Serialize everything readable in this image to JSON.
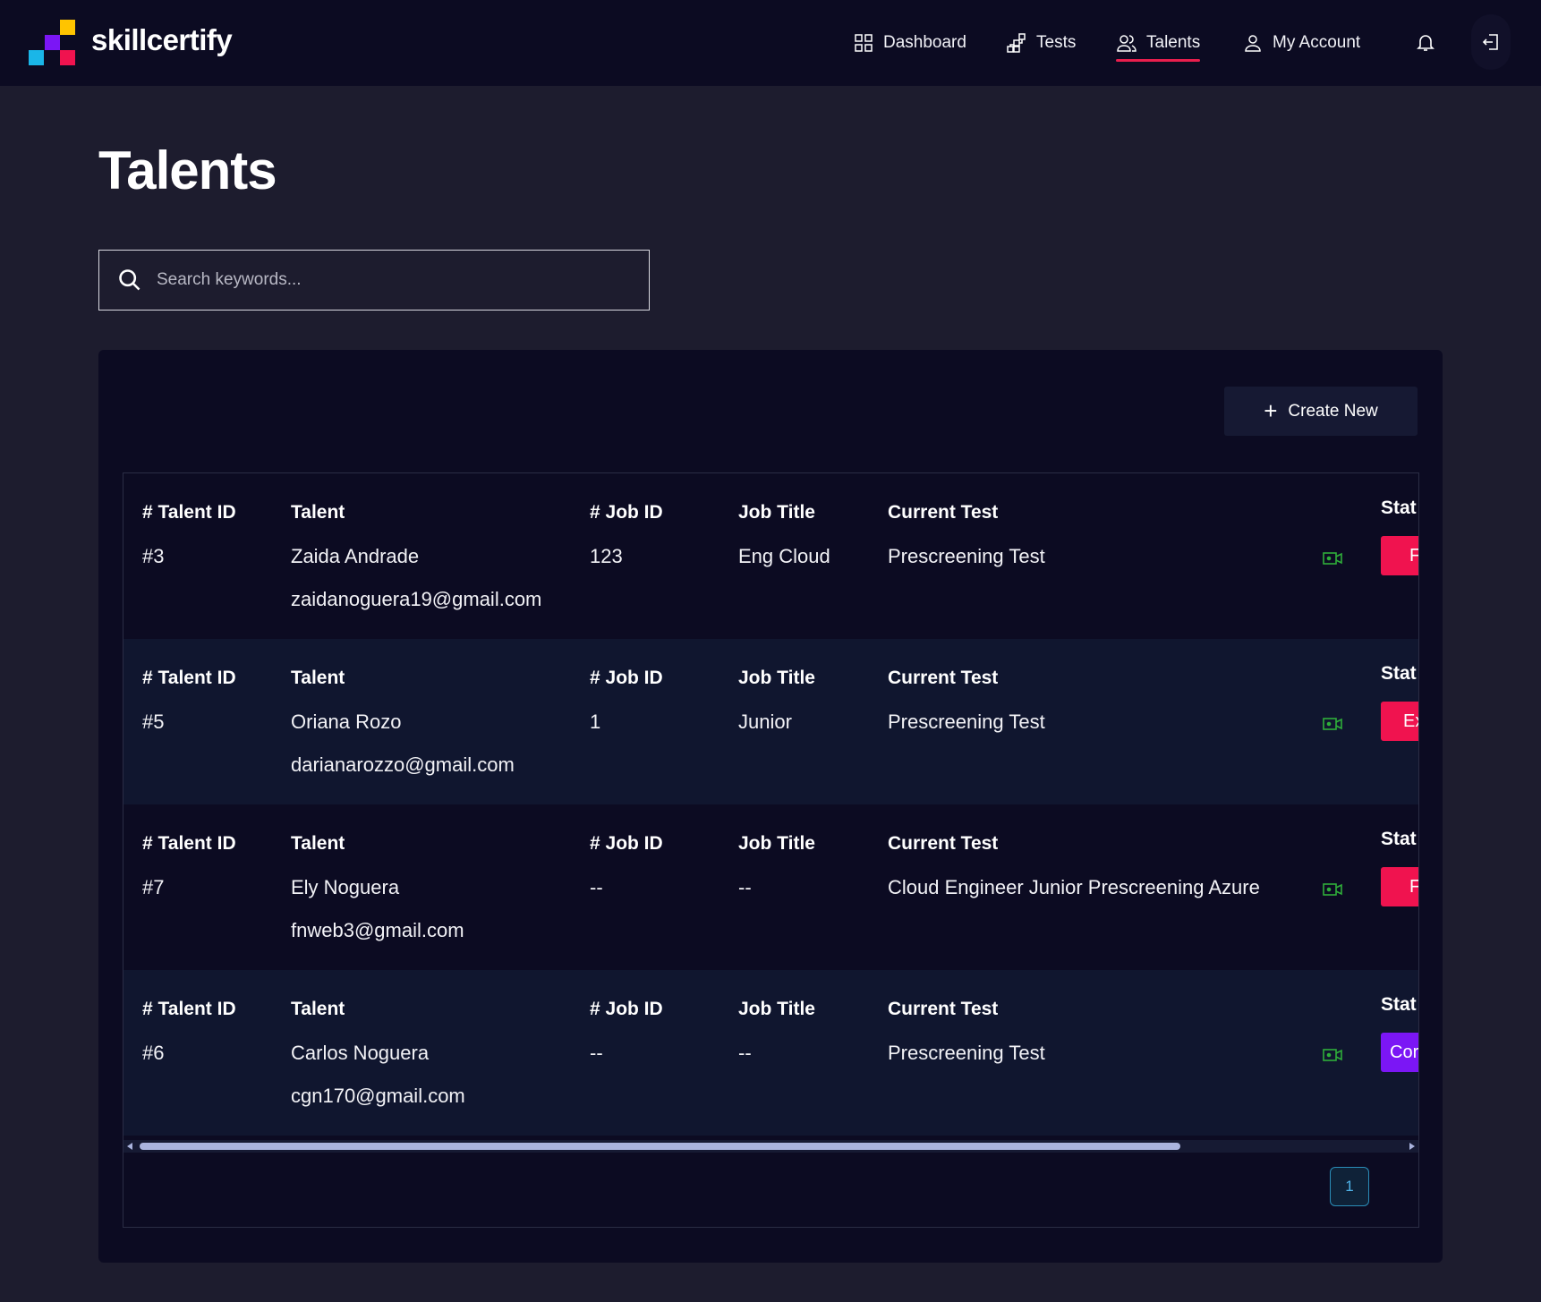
{
  "brand": {
    "name": "skillcertify"
  },
  "nav": {
    "dashboard": "Dashboard",
    "tests": "Tests",
    "talents": "Talents",
    "account": "My Account"
  },
  "page": {
    "title": "Talents"
  },
  "search": {
    "placeholder": "Search keywords..."
  },
  "toolbar": {
    "create_label": "Create New"
  },
  "columns": {
    "talent_id": "# Talent ID",
    "talent": "Talent",
    "job_id": "# Job ID",
    "job_title": "Job Title",
    "current_test": "Current Test",
    "status": "Stat"
  },
  "rows": [
    {
      "talent_id": "#3",
      "name": "Zaida Andrade",
      "email": "zaidanoguera19@gmail.com",
      "job_id": "123",
      "job_title": "Eng Cloud",
      "current_test": "Prescreening Test",
      "status": "F",
      "status_color": "#f0134f"
    },
    {
      "talent_id": "#5",
      "name": "Oriana Rozo",
      "email": "darianarozzo@gmail.com",
      "job_id": "1",
      "job_title": "Junior",
      "current_test": "Prescreening Test",
      "status": "Ex",
      "status_color": "#f0134f"
    },
    {
      "talent_id": "#7",
      "name": "Ely Noguera",
      "email": "fnweb3@gmail.com",
      "job_id": "--",
      "job_title": "--",
      "current_test": "Cloud Engineer Junior Prescreening Azure",
      "status": "F",
      "status_color": "#f0134f"
    },
    {
      "talent_id": "#6",
      "name": "Carlos Noguera",
      "email": "cgn170@gmail.com",
      "job_id": "--",
      "job_title": "--",
      "current_test": "Prescreening Test",
      "status": "Cor",
      "status_color": "#7b16f5"
    }
  ],
  "pagination": {
    "current": "1"
  },
  "icons": {
    "search": "search-icon",
    "dashboard": "grid-icon",
    "tests": "diagram-icon",
    "talents": "users-icon",
    "account": "user-icon",
    "bell": "bell-icon",
    "logout": "logout-icon",
    "video": "video-icon"
  },
  "colors": {
    "accent": "#e91e4d",
    "logo": [
      "#ffc400",
      "#7b16f5",
      "#f0134f",
      "#1ab6e8"
    ],
    "video_icon": "#2fae3a"
  }
}
